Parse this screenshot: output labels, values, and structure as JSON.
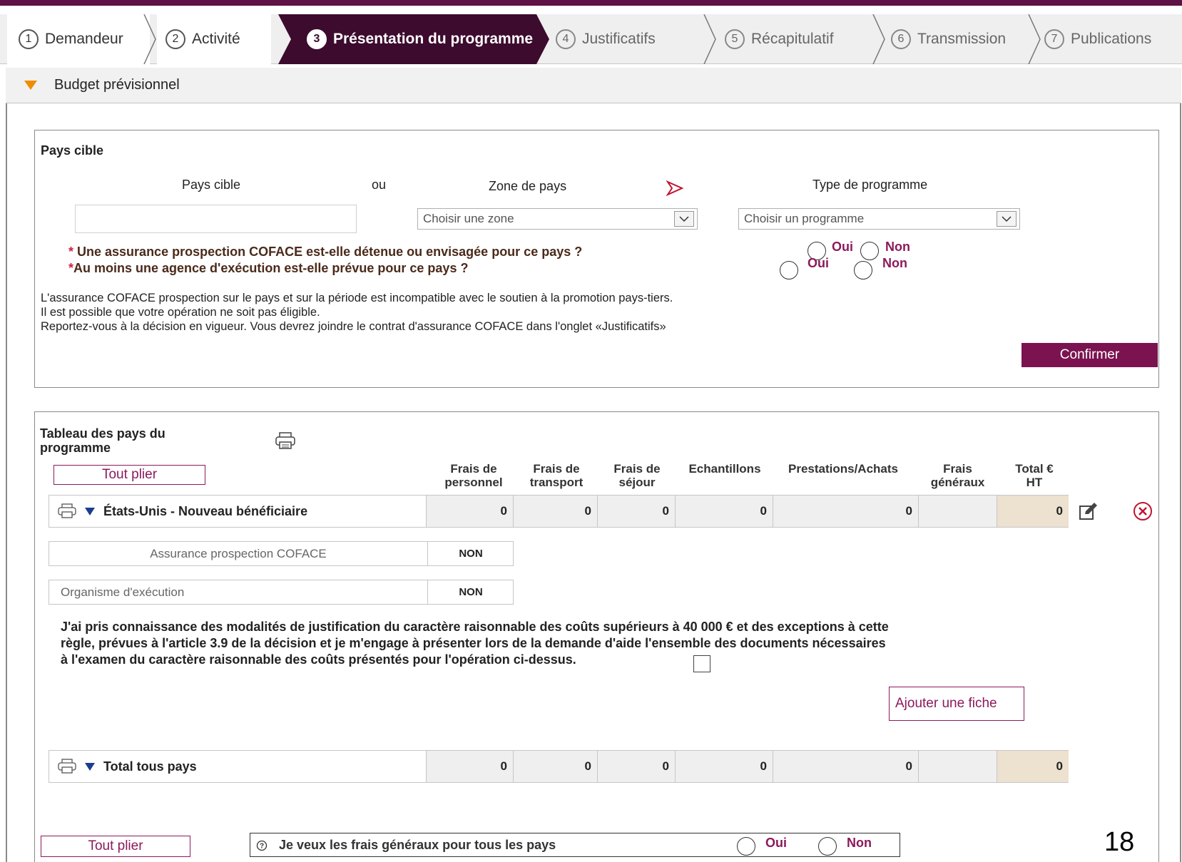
{
  "steps": [
    {
      "num": "1",
      "label": "Demandeur"
    },
    {
      "num": "2",
      "label": "Activité"
    },
    {
      "num": "3",
      "label": "Présentation du programme"
    },
    {
      "num": "4",
      "label": "Justificatifs"
    },
    {
      "num": "5",
      "label": "Récapitulatif"
    },
    {
      "num": "6",
      "label": "Transmission"
    },
    {
      "num": "7",
      "label": "Publications"
    }
  ],
  "section": {
    "title": "Budget prévisionnel"
  },
  "pays_cible": {
    "panel_title": "Pays cible",
    "col_pays": "Pays cible",
    "ou": "ou",
    "col_zone": "Zone de pays",
    "col_type": "Type de programme",
    "pays_value": "",
    "zone_placeholder": "Choisir une zone",
    "programme_placeholder": "Choisir un programme",
    "question1": "Une assurance prospection COFACE est-elle détenue ou envisagée pour ce pays ?",
    "question2": "Au moins une agence d'exécution est-elle prévue pour ce pays ?",
    "oui": "Oui",
    "non": "Non",
    "notice_line1": "L'assurance COFACE prospection sur le pays et sur la période est incompatible avec le soutien à la promotion pays-tiers.",
    "notice_line2": "Il est possible que votre opération ne soit pas éligible.",
    "notice_line3": "Reportez-vous à la décision en vigueur. Vous devrez joindre le contrat d'assurance COFACE dans l'onglet «Justificatifs»",
    "confirm_label": "Confirmer"
  },
  "tableau": {
    "title_line1": "Tableau des pays du",
    "title_line2": "programme",
    "tout_plier": "Tout plier",
    "headers": [
      {
        "l1": "Frais de",
        "l2": "personnel"
      },
      {
        "l1": "Frais de",
        "l2": "transport"
      },
      {
        "l1": "Frais de",
        "l2": "séjour"
      },
      {
        "l1": "",
        "l2": "Echantillons"
      },
      {
        "l1": "",
        "l2": "Prestations/Achats"
      },
      {
        "l1": "Frais",
        "l2": "généraux"
      },
      {
        "l1": "Total €",
        "l2": "HT"
      }
    ],
    "country_row": {
      "name": "États-Unis - Nouveau bénéficiaire",
      "values": [
        "0",
        "0",
        "0",
        "0",
        "0",
        "",
        "0"
      ]
    },
    "assurance_label": "Assurance prospection COFACE",
    "assurance_value": "NON",
    "organisme_label": "Organisme d'exécution",
    "organisme_value": "NON",
    "engagement_line1": "J'ai pris connaissance des modalités de justification du caractère raisonnable des coûts supérieurs à 40 000 € et des exceptions à cette",
    "engagement_line2": "règle, prévues à l'article 3.9 de la décision et je m'engage à présenter lors de la demande d'aide l'ensemble des documents nécessaires",
    "engagement_line3": "à l'examen du caractère raisonnable des coûts présentés pour l'opération ci-dessus.",
    "ajouter_label": "Ajouter une fiche",
    "total_row": {
      "name": "Total tous pays",
      "values": [
        "0",
        "0",
        "0",
        "0",
        "0",
        "",
        "0"
      ]
    }
  },
  "footer": {
    "tout_plier": "Tout plier",
    "frais_generaux_question": "Je veux les frais généraux pour tous les pays",
    "oui": "Oui",
    "non": "Non",
    "page_number": "18"
  },
  "colors": {
    "accent": "#7a1350",
    "active_step": "#3c0b2e",
    "orange": "#f08c00",
    "total_cell": "#ede1cf"
  }
}
